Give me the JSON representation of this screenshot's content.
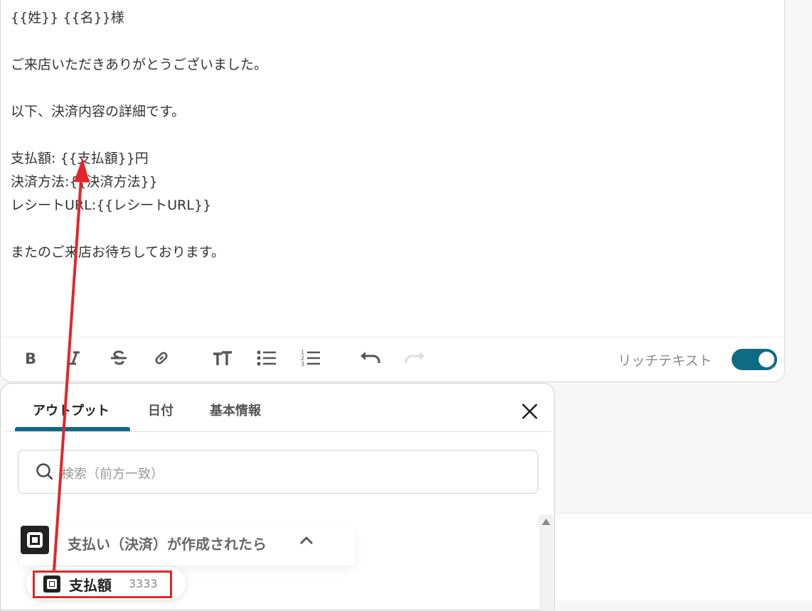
{
  "editor": {
    "lines": [
      "{{姓}} {{名}}様",
      "",
      "ご来店いただきありがとうございました。",
      "",
      "以下、決済内容の詳細です。",
      "",
      "支払額: {{支払額}}円",
      "決済方法:{{決済方法}}",
      "レシートURL:{{レシートURL}}",
      "",
      "またのご来店お待ちしております。"
    ]
  },
  "toolbar": {
    "buttons": [
      "bold-icon",
      "italic-icon",
      "strikethrough-icon",
      "link-icon",
      "text-size-icon",
      "bulleted-list-icon",
      "numbered-list-icon",
      "undo-icon",
      "redo-icon"
    ],
    "rich_text_label": "リッチテキスト",
    "rich_text_enabled": true
  },
  "panel": {
    "tabs": [
      {
        "label": "アウトプット",
        "active": true
      },
      {
        "label": "日付",
        "active": false
      },
      {
        "label": "基本情報",
        "active": false
      }
    ],
    "search_placeholder": "検索（前方一致）",
    "group": {
      "title": "支払い（決済）が作成されたら",
      "expanded": true
    },
    "item": {
      "name": "支払額",
      "value": "3333"
    }
  },
  "colors": {
    "accent": "#0f6b83",
    "annotation": "#e2262a"
  }
}
